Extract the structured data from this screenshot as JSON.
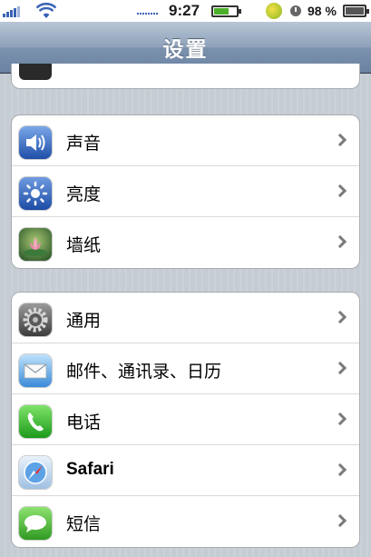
{
  "status": {
    "time": "9:27",
    "battery_percent": "98 %",
    "small_battery_level": 0.6,
    "battery_level": 0.98
  },
  "nav": {
    "title": "设置"
  },
  "groups": [
    {
      "items": [
        {
          "label": "声音",
          "icon": "sound-icon"
        },
        {
          "label": "亮度",
          "icon": "brightness-icon"
        },
        {
          "label": "墙纸",
          "icon": "wallpaper-icon"
        }
      ]
    },
    {
      "items": [
        {
          "label": "通用",
          "icon": "gear-icon"
        },
        {
          "label": "邮件、通讯录、日历",
          "icon": "mail-icon"
        },
        {
          "label": "电话",
          "icon": "phone-icon"
        },
        {
          "label": "Safari",
          "icon": "safari-icon"
        },
        {
          "label": "短信",
          "icon": "messages-icon"
        }
      ]
    }
  ],
  "colors": {
    "background": "#c5ccd4",
    "navbar": "#7c92ae",
    "chevron": "#7b7b7b"
  }
}
